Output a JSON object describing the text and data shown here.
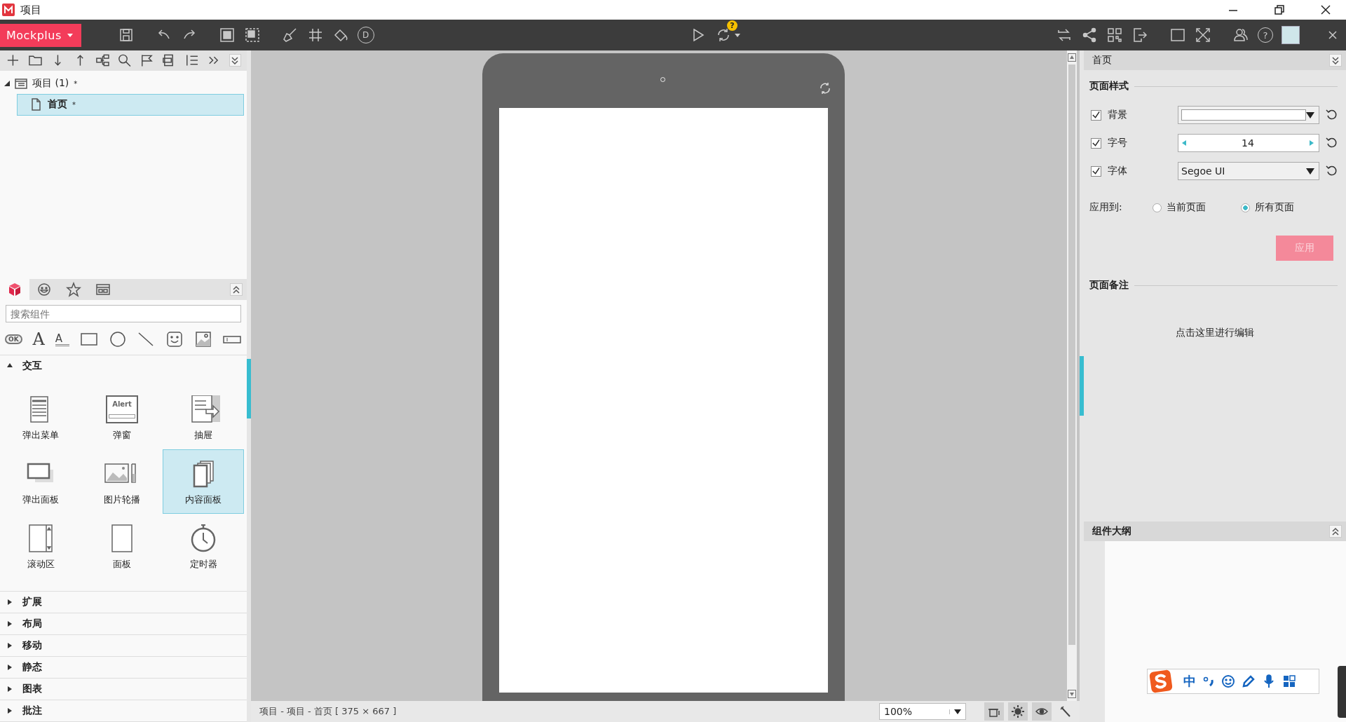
{
  "window": {
    "title": "项目"
  },
  "toolbar": {
    "brand": "Mockplus",
    "d_button": "D",
    "sync_badge": "?",
    "help_button": "?"
  },
  "project_tree": {
    "items": [
      {
        "label": "项目 (1)",
        "badge": "*",
        "expanded": true,
        "selected": false,
        "children": [
          {
            "label": "首页",
            "badge": "*",
            "selected": true
          }
        ]
      }
    ]
  },
  "palette": {
    "tabs": [
      {
        "kind": "cube",
        "selected": true
      },
      {
        "kind": "smile",
        "selected": false
      },
      {
        "kind": "star",
        "selected": false
      },
      {
        "kind": "layout",
        "selected": false
      }
    ],
    "search": {
      "placeholder": "搜索组件"
    },
    "shapes": [
      {
        "kind": "button",
        "text": "OK"
      },
      {
        "kind": "text",
        "text": "A"
      },
      {
        "kind": "paragraph",
        "text": "A"
      },
      {
        "kind": "rect"
      },
      {
        "kind": "circle"
      },
      {
        "kind": "line"
      },
      {
        "kind": "emoji"
      },
      {
        "kind": "image"
      },
      {
        "kind": "input"
      }
    ],
    "alert_icon_text": "Alert",
    "categories": [
      {
        "label": "交互",
        "expanded": true,
        "items": [
          {
            "label": "弹出菜单",
            "kind": "menu",
            "selected": false
          },
          {
            "label": "弹窗",
            "kind": "alert",
            "selected": false
          },
          {
            "label": "抽屉",
            "kind": "drawer",
            "selected": false
          },
          {
            "label": "弹出面板",
            "kind": "popup",
            "selected": false
          },
          {
            "label": "图片轮播",
            "kind": "carousel",
            "selected": false
          },
          {
            "label": "内容面板",
            "kind": "pages",
            "selected": true
          },
          {
            "label": "滚动区",
            "kind": "scroll",
            "selected": false
          },
          {
            "label": "面板",
            "kind": "panel",
            "selected": false
          },
          {
            "label": "定时器",
            "kind": "timer",
            "selected": false
          }
        ]
      },
      {
        "label": "扩展",
        "expanded": false
      },
      {
        "label": "布局",
        "expanded": false
      },
      {
        "label": "移动",
        "expanded": false
      },
      {
        "label": "静态",
        "expanded": false
      },
      {
        "label": "图表",
        "expanded": false
      },
      {
        "label": "批注",
        "expanded": false
      }
    ]
  },
  "status_bar": {
    "path": "项目 - 项目 - 首页 [ 375 × 667 ]",
    "zoom": "100%"
  },
  "properties": {
    "page_title": "首页",
    "style_section": "页面样式",
    "rows": [
      {
        "kind": "color",
        "label": "背景",
        "checked": true
      },
      {
        "kind": "stepper",
        "label": "字号",
        "checked": true,
        "value": "14"
      },
      {
        "kind": "select",
        "label": "字体",
        "checked": true,
        "value": "Segoe UI"
      }
    ],
    "apply_to": {
      "label": "应用到:",
      "options": [
        {
          "label": "当前页面",
          "selected": false
        },
        {
          "label": "所有页面",
          "selected": true
        }
      ]
    },
    "apply_button": {
      "label": "应用",
      "disabled": true
    },
    "notes_section": "页面备注",
    "notes_placeholder": "点击这里进行编辑",
    "outline_section": "组件大纲"
  },
  "ime_bar": {
    "mode": "中"
  }
}
